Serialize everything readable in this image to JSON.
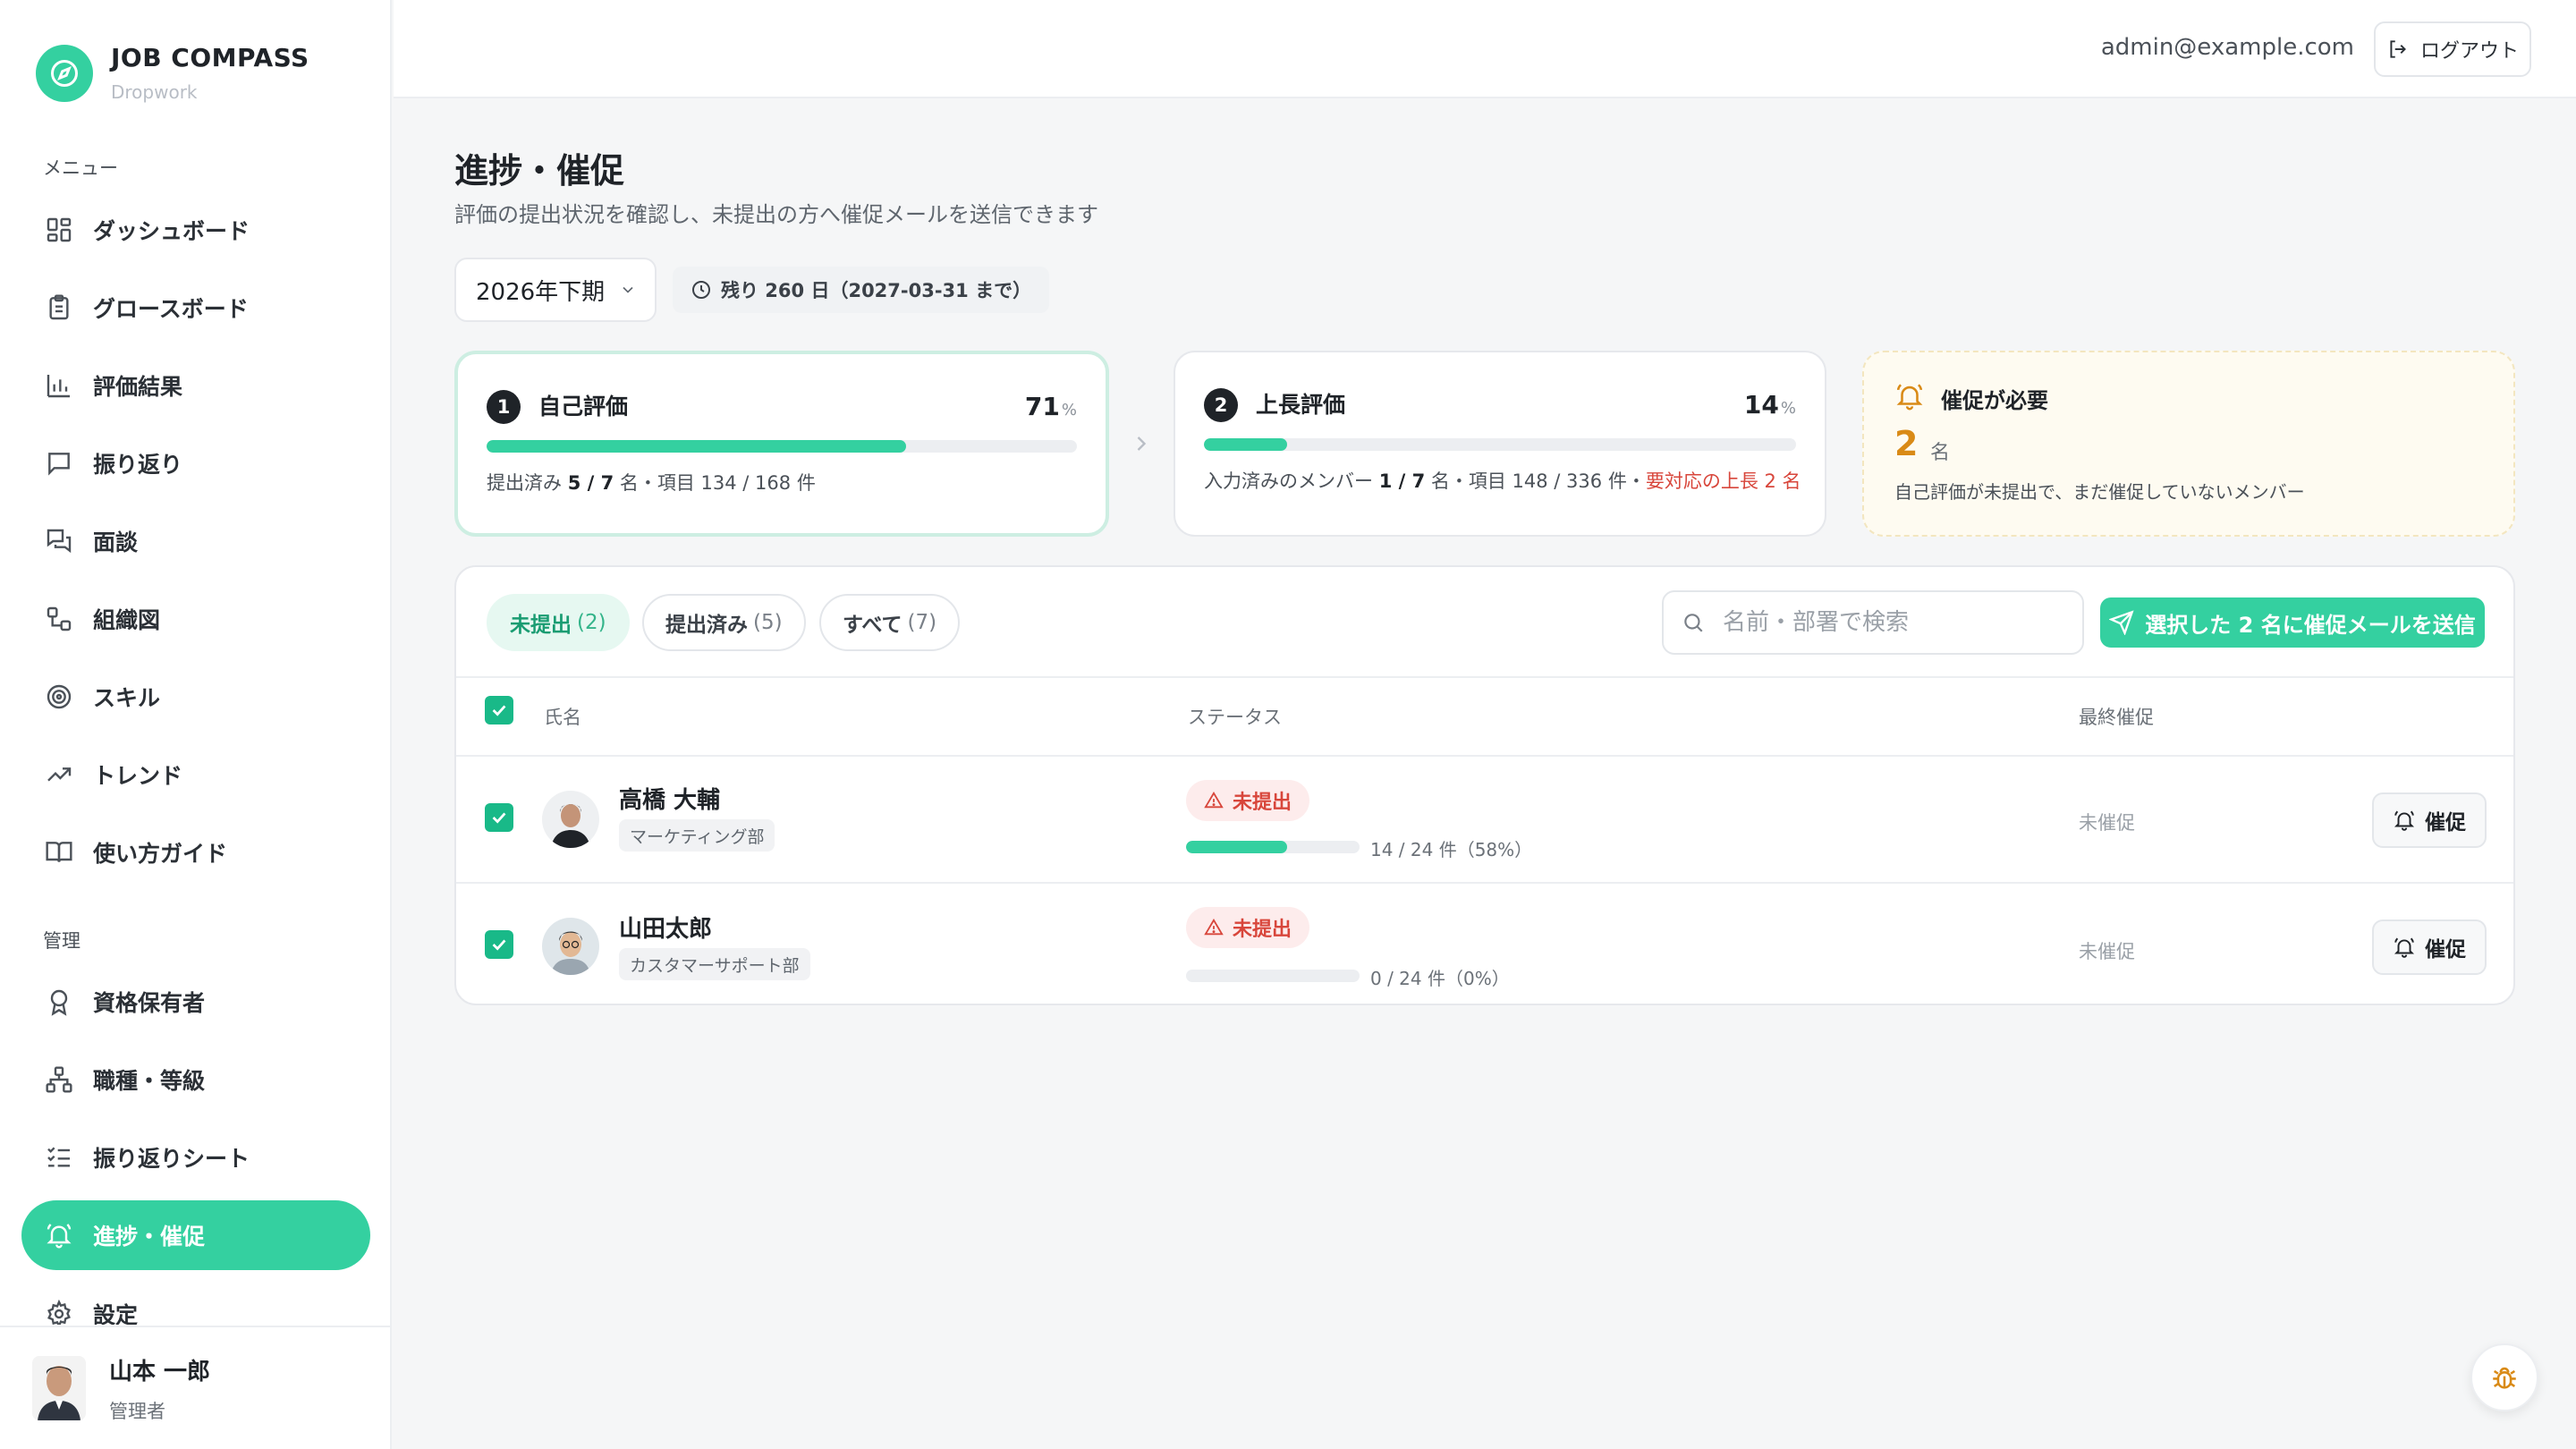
{
  "brand": {
    "title": "JOB COMPASS",
    "subtitle": "Dropwork"
  },
  "sidebar": {
    "menu_label": "メニュー",
    "menu_items": [
      {
        "label": "ダッシュボード",
        "icon": "dashboard-icon"
      },
      {
        "label": "グロースボード",
        "icon": "clipboard-icon"
      },
      {
        "label": "評価結果",
        "icon": "bar-chart-icon"
      },
      {
        "label": "振り返り",
        "icon": "message-square-icon"
      },
      {
        "label": "面談",
        "icon": "messages-icon"
      },
      {
        "label": "組織図",
        "icon": "org-chart-icon"
      },
      {
        "label": "スキル",
        "icon": "target-icon"
      },
      {
        "label": "トレンド",
        "icon": "trending-up-icon"
      },
      {
        "label": "使い方ガイド",
        "icon": "book-icon"
      }
    ],
    "admin_label": "管理",
    "admin_items": [
      {
        "label": "資格保有者",
        "icon": "award-icon"
      },
      {
        "label": "職種・等級",
        "icon": "hierarchy-icon"
      },
      {
        "label": "振り返りシート",
        "icon": "checklist-icon"
      },
      {
        "label": "進捗・催促",
        "icon": "bell-icon",
        "active": true
      },
      {
        "label": "設定",
        "icon": "gear-icon"
      }
    ],
    "user": {
      "name": "山本 一郎",
      "role": "管理者"
    }
  },
  "topbar": {
    "email": "admin@example.com",
    "logout_label": "ログアウト"
  },
  "page": {
    "title": "進捗・催促",
    "description": "評価の提出状況を確認し、未提出の方へ催促メールを送信できます",
    "period": "2026年下期",
    "remaining": "残り 260 日（2027-03-31 まで）"
  },
  "cards": {
    "self": {
      "step": "1",
      "title": "自己評価",
      "percent": "71",
      "percent_sign": "%",
      "progress": 0.71,
      "foot_prefix": "提出済み ",
      "foot_count": "5 / 7",
      "foot_suffix": " 名・項目 134 / 168 件"
    },
    "boss": {
      "step": "2",
      "title": "上長評価",
      "percent": "14",
      "percent_sign": "%",
      "progress": 0.14,
      "foot_prefix": "入力済みのメンバー ",
      "foot_count": "1 / 7",
      "foot_suffix": " 名・項目 148 / 336 件・",
      "foot_warn": "要対応の上長 2 名"
    },
    "remind": {
      "title": "催促が必要",
      "count": "2",
      "unit": "名",
      "description": "自己評価が未提出で、まだ催促していないメンバー"
    }
  },
  "filters": [
    {
      "label": "未提出",
      "count": "(2)",
      "active": true
    },
    {
      "label": "提出済み",
      "count": "(5)"
    },
    {
      "label": "すべて",
      "count": "(7)"
    }
  ],
  "search": {
    "placeholder": "名前・部署で検索",
    "value": ""
  },
  "send_button": "選択した 2 名に催促メールを送信",
  "table": {
    "headers": {
      "name": "氏名",
      "status": "ステータス",
      "last_remind": "最終催促"
    },
    "rows": [
      {
        "name": "高橋 大輔",
        "dept": "マーケティング部",
        "status": "未提出",
        "progress": 0.58,
        "progress_text": "14 / 24 件（58%）",
        "last_remind": "未催促",
        "action": "催促",
        "checked": true
      },
      {
        "name": "山田太郎",
        "dept": "カスタマーサポート部",
        "status": "未提出",
        "progress": 0.0,
        "progress_text": "0 / 24 件（0%）",
        "last_remind": "未催促",
        "action": "催促",
        "checked": true
      }
    ]
  },
  "colors": {
    "accent": "#34d0a0",
    "warning": "#d98a16",
    "danger": "#d8463b"
  }
}
